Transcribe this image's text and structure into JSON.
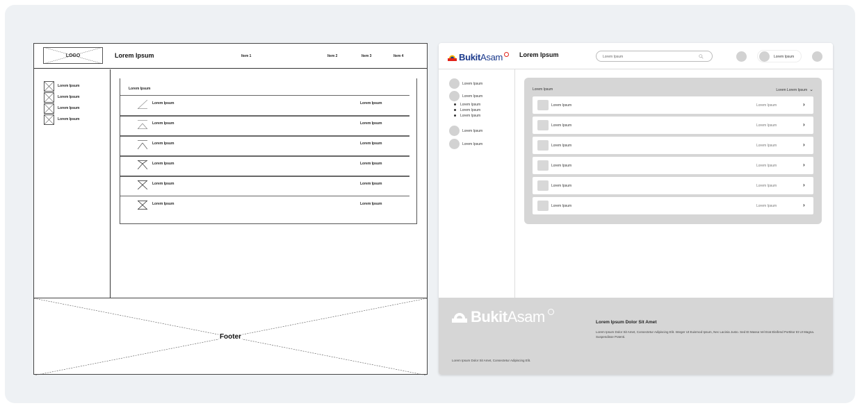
{
  "wireframe": {
    "logo_label": "LOGO",
    "title": "Lorem Ipsum",
    "nav": [
      "Item 1",
      "Item 2",
      "Item 3",
      "Item 4"
    ],
    "sidebar_items": [
      "Lorem Ipsum",
      "Lorem Ipsum",
      "Lorem Ipsum",
      "Lorem Ipsum"
    ],
    "content_title": "Lorem Ipsum",
    "rows": [
      {
        "label": "Lorem Ipsum",
        "value": "Lorem Ipsum"
      },
      {
        "label": "Lorem Ipsum",
        "value": "Lorem Ipsum"
      },
      {
        "label": "Lorem Ipsum",
        "value": "Lorem Ipsum"
      },
      {
        "label": "Lorem Ipsum",
        "value": "Lorem Ipsum"
      },
      {
        "label": "Lorem Ipsum",
        "value": "Lorem Ipsum"
      },
      {
        "label": "Lorem Ipsum",
        "value": "Lorem Ipsum"
      }
    ],
    "footer_label": "Footer"
  },
  "mockup": {
    "brand_bold": "Bukit",
    "brand_regular": "Asam",
    "title": "Lorem Ipsum",
    "search_value": "Lorem Ipsum",
    "user_label": "Lorem Ipsum",
    "sidebar": {
      "item1": "Lorem Ipsum",
      "item2": "Lorem Ipsum",
      "subitems": [
        "Lorem Ipsum",
        "Lorem Ipsum",
        "Lorem Ipsum"
      ],
      "item3": "Lorem Ipsum",
      "item4": "Lorem Ipsum"
    },
    "panel_title": "Lorem Ipsum",
    "panel_filter": "Lorem Lorem Ipsum",
    "rows": [
      {
        "label": "Lorem Ipsum",
        "value": "Lorem Ipsum"
      },
      {
        "label": "Lorem Ipsum",
        "value": "Lorem Ipsum"
      },
      {
        "label": "Lorem Ipsum",
        "value": "Lorem Ipsum"
      },
      {
        "label": "Lorem Ipsum",
        "value": "Lorem Ipsum"
      },
      {
        "label": "Lorem Ipsum",
        "value": "Lorem Ipsum"
      },
      {
        "label": "Lorem Ipsum",
        "value": "Lorem Ipsum"
      }
    ],
    "footer": {
      "heading": "Lorem Ipsum Dolor Sit Amet",
      "text": "Lorem Ipsum Dolor Sit Amet, Consectetur Adipiscing Elit. Integer Ut Euismod Ipsum, Nec Lacinia Justo. Sed Et Massa Vel Erat Eleifend Porttitor Et Ut Magna. Suspendisse Potenti.",
      "small": "Lorem Ipsum Dolor Sit Amet, Consectetur Adipiscing Elit."
    },
    "colors": {
      "brand_blue": "#1b3a8c",
      "brand_red": "#e2231a",
      "brand_yellow": "#f7b500",
      "panel_gray": "#d6d6d6"
    }
  }
}
